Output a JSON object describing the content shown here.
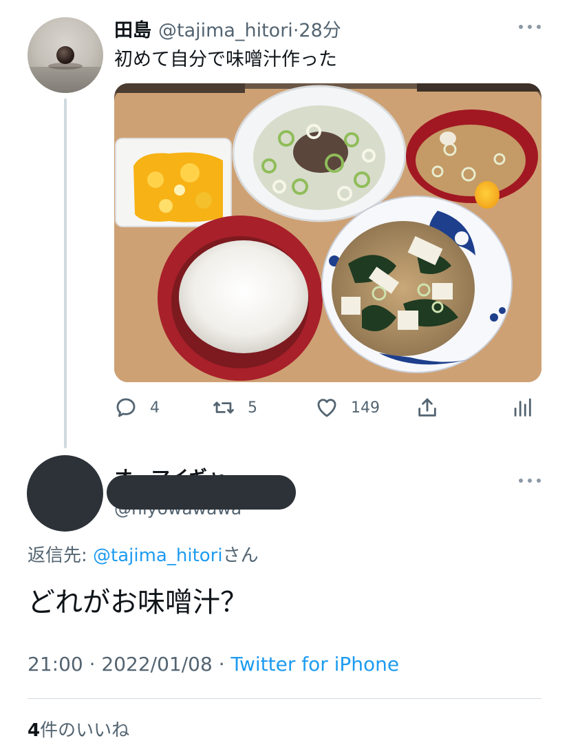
{
  "main_tweet": {
    "display_name": "田島",
    "handle": "@tajima_hitori",
    "separator": "·",
    "time_ago": "28分",
    "text": "初めて自分で味噌汁作った",
    "media_icon": "food-photo",
    "actions": {
      "reply_count": "4",
      "retweet_count": "5",
      "like_count": "149"
    }
  },
  "reply": {
    "display_name_partial": "オーマイギャ",
    "handle_partial": "@hiyowawawa",
    "reply_to_prefix": "返信先: ",
    "reply_to_mention": "@tajima_hitori",
    "reply_to_suffix": "さん",
    "text": "どれがお味噌汁？",
    "time": "21:00",
    "separator": " · ",
    "date": "2022/01/08",
    "source": "Twitter for iPhone",
    "likes_count": "4",
    "likes_label": "件のいいね"
  },
  "colors": {
    "accent": "#1d9bf0",
    "secondary_text": "#536471",
    "primary_text": "#0f1419",
    "redaction": "#2c3238"
  }
}
